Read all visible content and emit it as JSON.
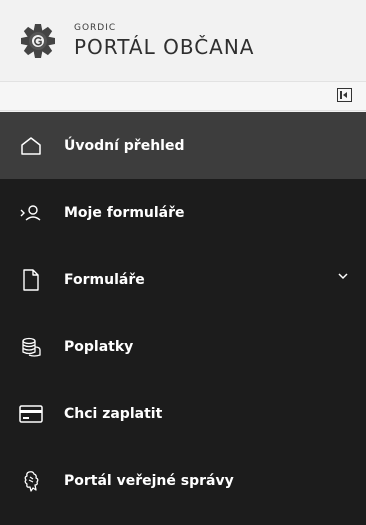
{
  "brand": {
    "small": "GORDIC",
    "title": "PORTÁL OBČANA"
  },
  "collapse": {
    "icon": "sidebar-collapse-icon"
  },
  "nav": {
    "items": [
      {
        "label": "Úvodní přehled",
        "icon": "home-icon",
        "active": true
      },
      {
        "label": "Moje formuláře",
        "icon": "user-forms-icon"
      },
      {
        "label": "Formuláře",
        "icon": "document-icon",
        "expandable": true
      },
      {
        "label": "Poplatky",
        "icon": "coins-icon"
      },
      {
        "label": "Chci zaplatit",
        "icon": "credit-card-icon"
      },
      {
        "label": "Portál veřejné správy",
        "icon": "lion-crest-icon"
      }
    ]
  },
  "colors": {
    "sidebar": "#1c1c1c",
    "active": "#3d3d3d",
    "header": "#f2f2f2"
  }
}
